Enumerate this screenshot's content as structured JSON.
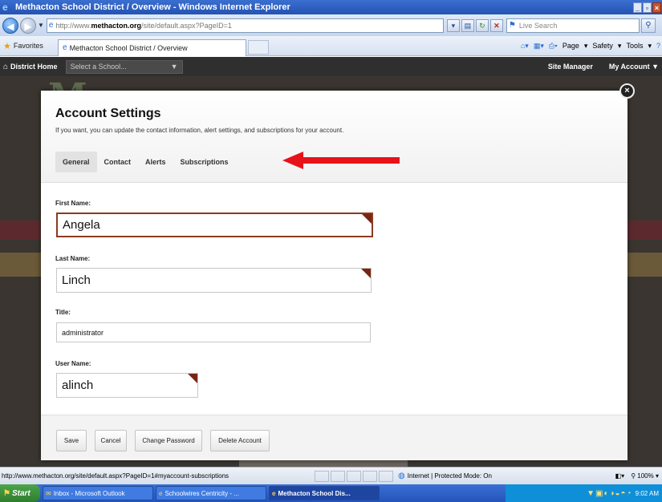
{
  "window": {
    "title": "Methacton School District / Overview - Windows Internet Explorer",
    "min": "_",
    "max": "▫",
    "close": "×"
  },
  "addressbar": {
    "url_prefix": "http://www.",
    "url_domain": "methacton.org",
    "url_suffix": "/site/default.aspx?PageID=1",
    "search_placeholder": "Live Search"
  },
  "favbar": {
    "favorites_label": "Favorites",
    "tab_title": "Methacton School District / Overview",
    "page_label": "Page",
    "safety_label": "Safety",
    "tools_label": "Tools"
  },
  "sitenav": {
    "home_label": "District Home",
    "school_select": "Select a School...",
    "site_manager": "Site Manager",
    "my_account": "My Account"
  },
  "modal": {
    "title": "Account Settings",
    "subtitle": "If you want, you can update the contact information, alert settings, and subscriptions for your account.",
    "tabs": {
      "general": "General",
      "contact": "Contact",
      "alerts": "Alerts",
      "subscriptions": "Subscriptions"
    },
    "fields": {
      "first_name_label": "First Name:",
      "first_name": "Angela",
      "last_name_label": "Last Name:",
      "last_name": "Linch",
      "title_label": "Title:",
      "title": "administrator",
      "username_label": "User Name:",
      "username": "alinch"
    },
    "buttons": {
      "save": "Save",
      "cancel": "Cancel",
      "change_password": "Change Password",
      "delete_account": "Delete Account"
    }
  },
  "statusbar": {
    "url": "http://www.methacton.org/site/default.aspx?PageID=1#myaccount-subscriptions",
    "zone": "Internet | Protected Mode: On",
    "zoom": "100%"
  },
  "taskbar": {
    "start": "Start",
    "tasks": [
      "Inbox - Microsoft Outlook",
      "Schoolwires Centricity - ...",
      "Methacton School Dis..."
    ],
    "time": "9:02 AM"
  },
  "colors": {
    "annotation_arrow": "#e8121a",
    "focus_border": "#8a3b22",
    "required_marker": "#7a2413"
  }
}
